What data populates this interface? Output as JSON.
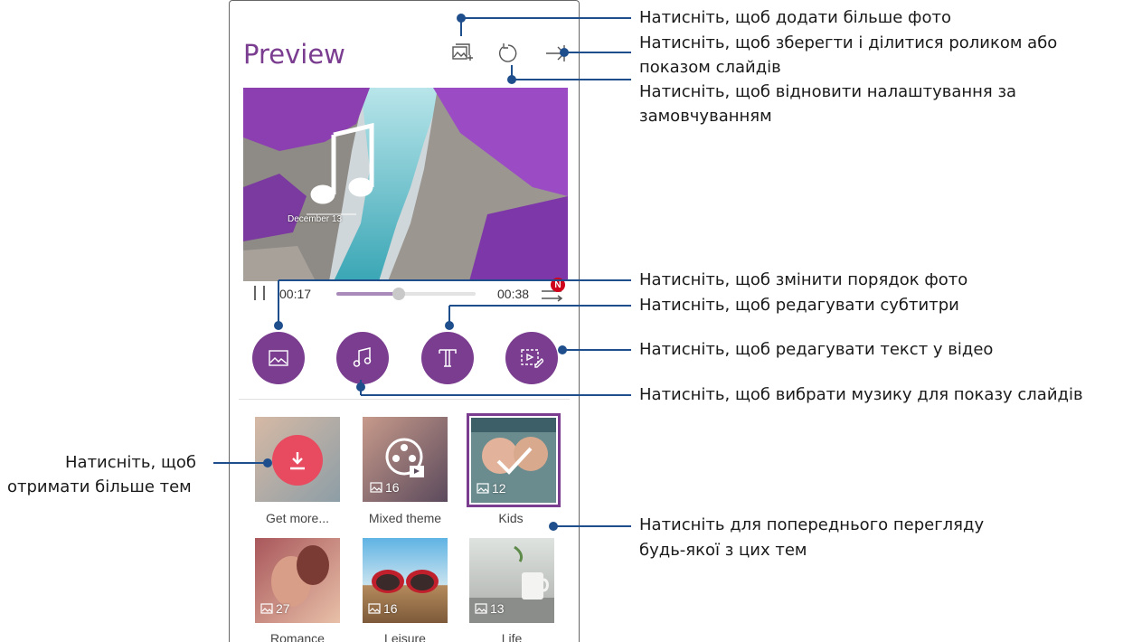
{
  "app": {
    "title": "Preview"
  },
  "hero": {
    "caption": "December 13"
  },
  "player": {
    "elapsed": "00:17",
    "total": "00:38",
    "progress_fraction": 0.45,
    "reorder_badge": "N"
  },
  "icons": {
    "add_photo": "add-photo-icon",
    "reset": "reset-icon",
    "share": "share-icon",
    "pause": "pause-icon",
    "reorder": "reorder-icon",
    "photo_edit": "image-icon",
    "music": "music-note-icon",
    "subtitle": "text-t-icon",
    "video_text": "video-text-edit-icon"
  },
  "themes": [
    {
      "name": "Get more...",
      "count": ""
    },
    {
      "name": "Mixed theme",
      "count": "16"
    },
    {
      "name": "Kids",
      "count": "12"
    },
    {
      "name": "Romance",
      "count": "27"
    },
    {
      "name": "Leisure",
      "count": "16"
    },
    {
      "name": "Life",
      "count": "13"
    }
  ],
  "annotations": {
    "add_photo": "Натисніть, щоб додати більше фото",
    "share_line1": "Натисніть, щоб зберегти і ділитися роликом або",
    "share_line2": "показом слайдів",
    "reset_line1": "Натисніть, щоб відновити налаштування за",
    "reset_line2": "замовчуванням",
    "reorder": "Натисніть, щоб змінити порядок фото",
    "subtitles": "Натисніть, щоб редагувати субтитри",
    "video_text": "Натисніть, щоб редагувати текст у відео",
    "music": "Натисніть, щоб вибрати музику для показу слайдів",
    "get_more_line1": "Натисніть, щоб",
    "get_more_line2": "отримати більше тем",
    "preview_line1": "Натисніть для попереднього перегляду",
    "preview_line2": "будь-якої з цих тем"
  },
  "colors": {
    "accent": "#7a3d8f",
    "callout": "#1f4e8c",
    "download": "#e84a5f"
  }
}
